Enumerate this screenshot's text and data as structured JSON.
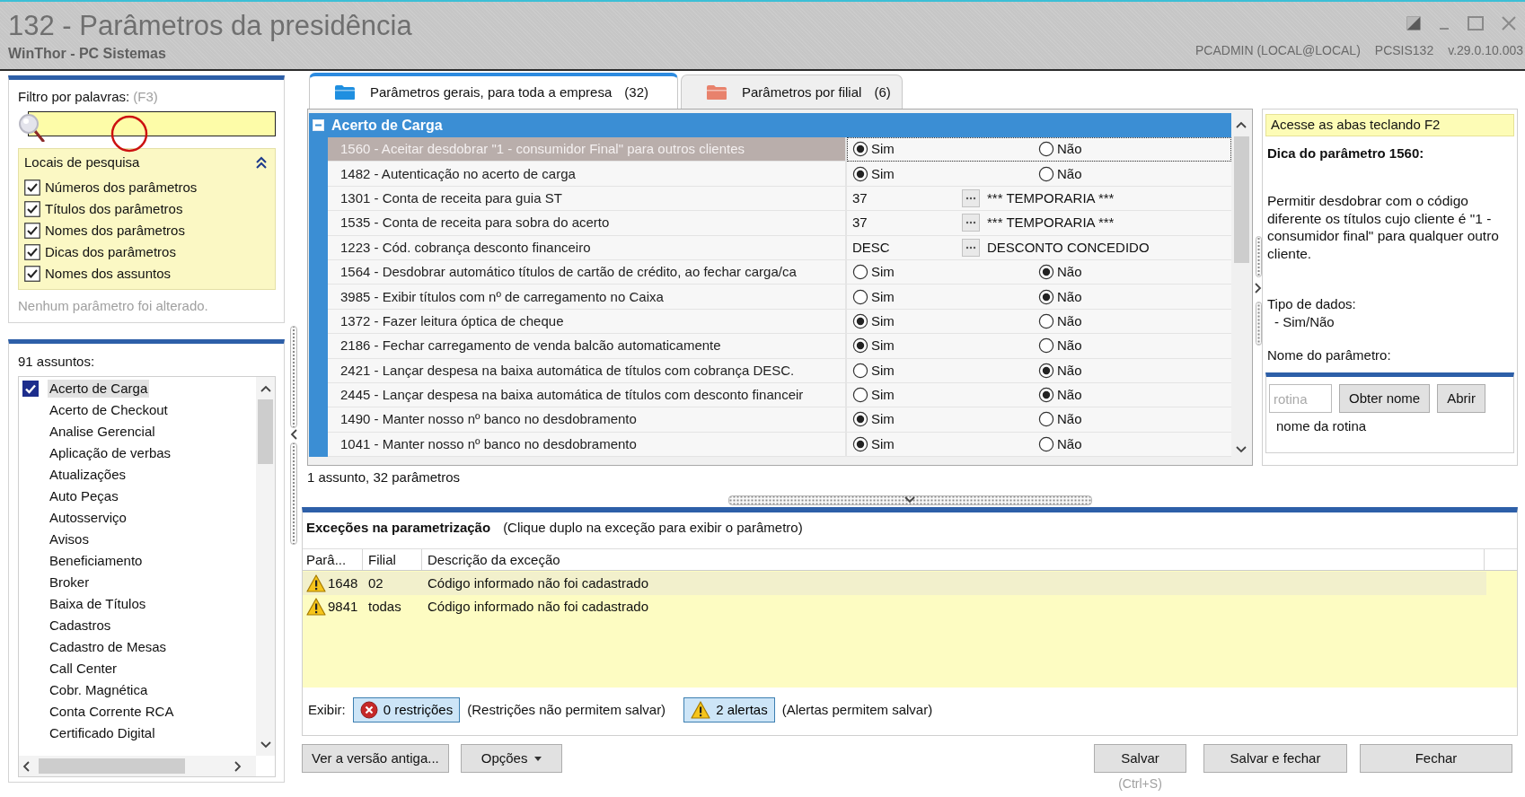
{
  "window": {
    "title": "132 - Parâmetros da presidência",
    "app": "WinThor - PC Sistemas",
    "user": "PCADMIN (LOCAL@LOCAL)",
    "program": "PCSIS132",
    "version": "v.29.0.10.003"
  },
  "filter": {
    "label": "Filtro por palavras:",
    "shortcut": "(F3)",
    "locations": {
      "title": "Locais de pesquisa",
      "expanded": true,
      "options": [
        {
          "label": "Números dos parâmetros",
          "checked": true
        },
        {
          "label": "Títulos dos parâmetros",
          "checked": true
        },
        {
          "label": "Nomes dos parâmetros",
          "checked": true
        },
        {
          "label": "Dicas dos parâmetros",
          "checked": true
        },
        {
          "label": "Nomes dos assuntos",
          "checked": true
        }
      ]
    },
    "status": "Nenhum parâmetro foi alterado."
  },
  "subjects": {
    "count": "91 assuntos:",
    "items": [
      {
        "label": "Acerto de Carga",
        "selected": true
      },
      {
        "label": "Acerto de Checkout",
        "selected": false
      },
      {
        "label": "Analise Gerencial",
        "selected": false
      },
      {
        "label": "Aplicação de verbas",
        "selected": false
      },
      {
        "label": "Atualizações",
        "selected": false
      },
      {
        "label": "Auto Peças",
        "selected": false
      },
      {
        "label": "Autosserviço",
        "selected": false
      },
      {
        "label": "Avisos",
        "selected": false
      },
      {
        "label": "Beneficiamento",
        "selected": false
      },
      {
        "label": "Broker",
        "selected": false
      },
      {
        "label": "Baixa de Títulos",
        "selected": false
      },
      {
        "label": "Cadastros",
        "selected": false
      },
      {
        "label": "Cadastro de Mesas",
        "selected": false
      },
      {
        "label": "Call Center",
        "selected": false
      },
      {
        "label": "Cobr. Magnética",
        "selected": false
      },
      {
        "label": "Conta Corrente RCA",
        "selected": false
      },
      {
        "label": "Certificado Digital",
        "selected": false
      }
    ]
  },
  "tabs": [
    {
      "label": "Parâmetros gerais, para toda a empresa",
      "count": "(32)",
      "selected": true,
      "color": "#1f8fe0"
    },
    {
      "label": "Parâmetros por filial",
      "count": "(6)",
      "selected": false,
      "color": "#e8826c"
    }
  ],
  "parameters": {
    "group": {
      "title": "Acerto de Carga",
      "expanded": true
    },
    "rows": [
      {
        "kind": "yesno",
        "label": "1560 - Aceitar desdobrar \"1 - consumidor Final\" para outros clientes",
        "selected": true,
        "options": [
          {
            "label": "Sim",
            "selected": true
          },
          {
            "label": "Não",
            "selected": false
          }
        ]
      },
      {
        "kind": "yesno",
        "label": "1482 - Autenticação no acerto de carga",
        "selected": false,
        "options": [
          {
            "label": "Sim",
            "selected": true
          },
          {
            "label": "Não",
            "selected": false
          }
        ]
      },
      {
        "kind": "lookup",
        "label": "1301 - Conta de receita para guia ST",
        "selected": false,
        "value": "37",
        "description": "*** TEMPORARIA ***"
      },
      {
        "kind": "lookup",
        "label": "1535 - Conta de receita para sobra do acerto",
        "selected": false,
        "value": "37",
        "description": "*** TEMPORARIA ***"
      },
      {
        "kind": "lookup",
        "label": "1223 - Cód. cobrança desconto financeiro",
        "selected": false,
        "value": "DESC",
        "description": "DESCONTO CONCEDIDO"
      },
      {
        "kind": "yesno",
        "label": "1564 - Desdobrar automático títulos de cartão de crédito, ao fechar carga/ca",
        "selected": false,
        "options": [
          {
            "label": "Sim",
            "selected": false
          },
          {
            "label": "Não",
            "selected": true
          }
        ]
      },
      {
        "kind": "yesno",
        "label": "3985 - Exibir títulos com nº de carregamento no Caixa",
        "selected": false,
        "options": [
          {
            "label": "Sim",
            "selected": false
          },
          {
            "label": "Não",
            "selected": true
          }
        ]
      },
      {
        "kind": "yesno",
        "label": "1372 - Fazer leitura óptica de cheque",
        "selected": false,
        "options": [
          {
            "label": "Sim",
            "selected": true
          },
          {
            "label": "Não",
            "selected": false
          }
        ]
      },
      {
        "kind": "yesno",
        "label": "2186 - Fechar carregamento de venda balcão automaticamente",
        "selected": false,
        "options": [
          {
            "label": "Sim",
            "selected": true
          },
          {
            "label": "Não",
            "selected": false
          }
        ]
      },
      {
        "kind": "yesno",
        "label": "2421 - Lançar despesa na baixa automática de títulos com cobrança DESC.",
        "selected": false,
        "options": [
          {
            "label": "Sim",
            "selected": false
          },
          {
            "label": "Não",
            "selected": true
          }
        ]
      },
      {
        "kind": "yesno",
        "label": "2445 - Lançar despesa na baixa automática de títulos com desconto financeir",
        "selected": false,
        "options": [
          {
            "label": "Sim",
            "selected": false
          },
          {
            "label": "Não",
            "selected": true
          }
        ]
      },
      {
        "kind": "yesno",
        "label": "1490 - Manter nosso nº banco no desdobramento",
        "selected": false,
        "options": [
          {
            "label": "Sim",
            "selected": true
          },
          {
            "label": "Não",
            "selected": false
          }
        ]
      },
      {
        "kind": "yesno",
        "label": "1041 - Manter nosso nº banco no desdobramento",
        "selected": false,
        "options": [
          {
            "label": "Sim",
            "selected": true
          },
          {
            "label": "Não",
            "selected": false
          }
        ]
      }
    ]
  },
  "summary": "1 assunto, 32 parâmetros",
  "hint": {
    "tip": "Acesse as abas teclando F2",
    "title": "Dica do parâmetro 1560:",
    "text": "Permitir desdobrar com o código diferente os títulos cujo cliente é \"1 - consumidor final\" para qualquer outro cliente.",
    "data_type_label": "Tipo de dados:",
    "data_type": "- Sim/Não",
    "name_label": "Nome do parâmetro:",
    "name_placeholder": "rotina",
    "buttons": [
      "Obter nome",
      "Abrir"
    ],
    "routine_name": "nome da rotina"
  },
  "exceptions": {
    "title": "Exceções na parametrização",
    "note": "(Clique duplo na exceção para exibir o parâmetro)",
    "columns": [
      "Parâ...",
      "Filial",
      "Descrição da exceção"
    ],
    "rows": [
      {
        "kind": "alert",
        "parameter": "1648",
        "branch": "02",
        "description": "Código informado não foi cadastrado",
        "selected": true
      },
      {
        "kind": "alert",
        "parameter": "9841",
        "branch": "todas",
        "description": "Código informado não foi cadastrado",
        "selected": false
      }
    ],
    "show_label": "Exibir:",
    "filters": [
      {
        "kind": "restriction",
        "label": "0 restrições",
        "note": "(Restrições não permitem salvar)",
        "on": true
      },
      {
        "kind": "alert",
        "label": "2 alertas",
        "note": "(Alertas permitem salvar)",
        "on": true
      }
    ]
  },
  "footer": {
    "left": [
      {
        "label": "Ver a versão antiga...",
        "kind": "plain"
      },
      {
        "label": "Opções",
        "kind": "menu"
      }
    ],
    "right": [
      {
        "label": "Salvar",
        "shortcut": "(Ctrl+S)"
      },
      {
        "label": "Salvar e fechar"
      },
      {
        "label": "Fechar"
      }
    ]
  }
}
